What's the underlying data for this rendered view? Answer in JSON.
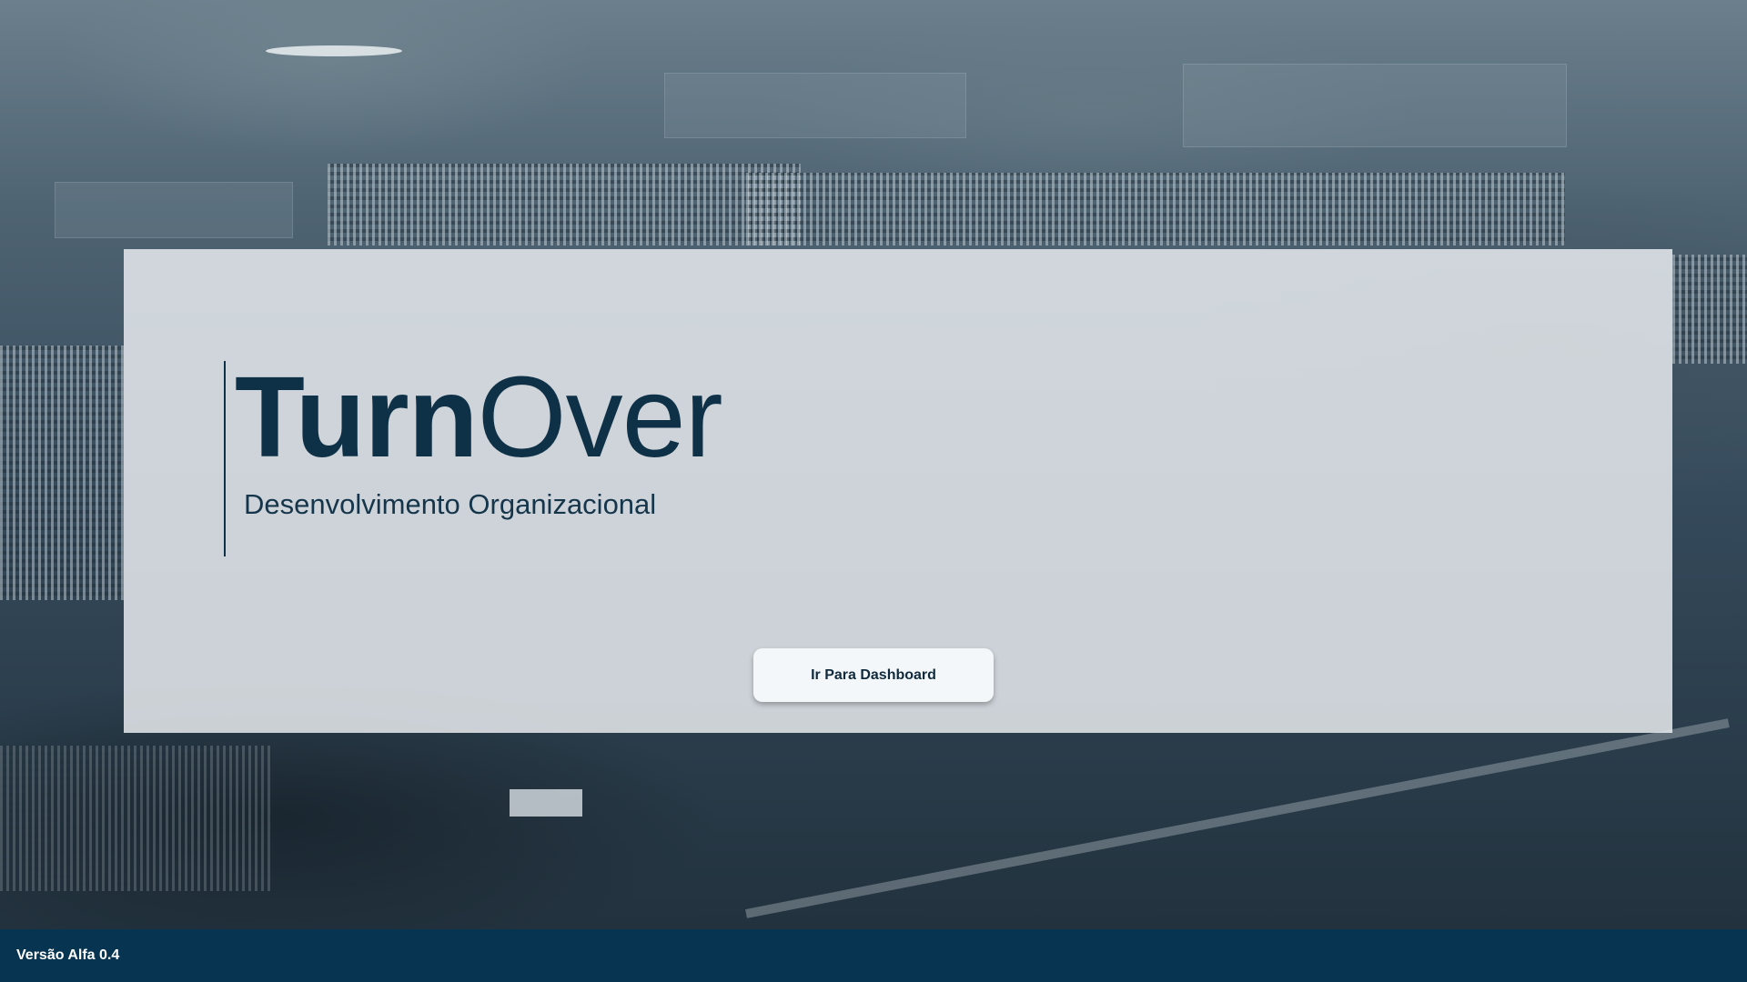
{
  "hero": {
    "title_bold": "Turn",
    "title_light": "Over",
    "subtitle": "Desenvolvimento Organizacional",
    "dashboard_button_label": "Ir Para Dashboard"
  },
  "footer": {
    "version_label": "Versão Alfa 0.4"
  },
  "colors": {
    "brand_dark": "#0f3148",
    "footer_bg": "#073551",
    "panel_bg": "#e6eaee"
  }
}
